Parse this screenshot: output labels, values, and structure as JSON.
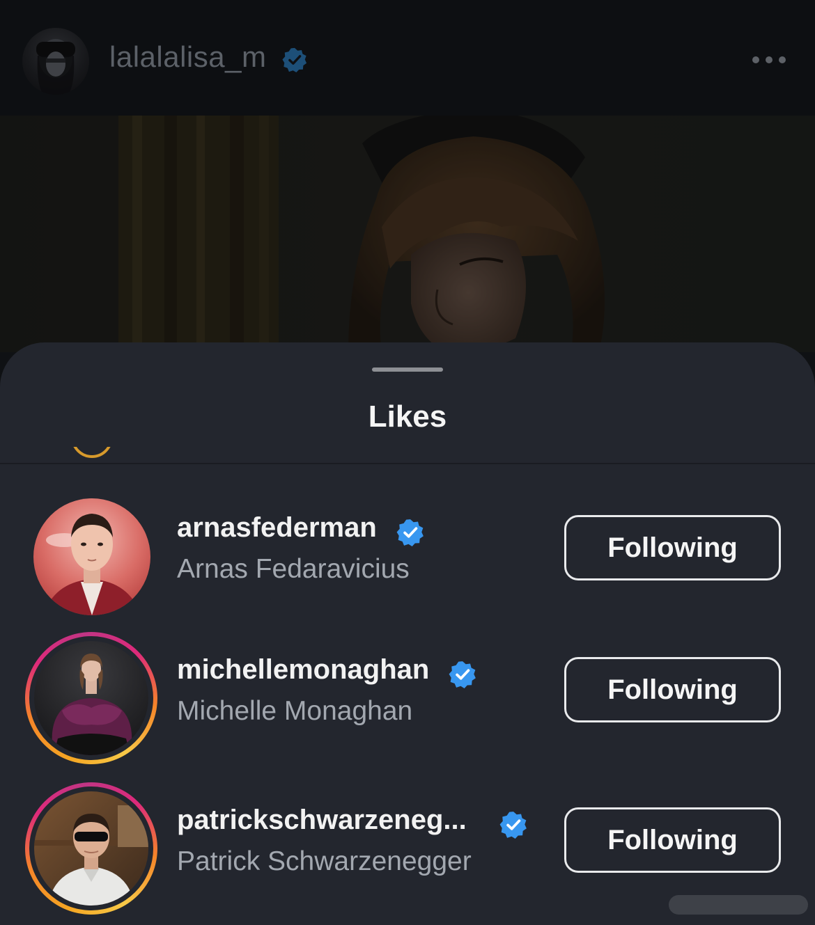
{
  "post": {
    "username": "lalalalisa_m",
    "verified": true,
    "more_icon": "more-horizontal-icon"
  },
  "sheet": {
    "title": "Likes"
  },
  "likes": [
    {
      "username": "arnasfederman",
      "full_name": "Arnas Fedaravicius",
      "verified": true,
      "has_story_ring": false,
      "button_label": "Following"
    },
    {
      "username": "michellemonaghan",
      "full_name": "Michelle Monaghan",
      "verified": true,
      "has_story_ring": true,
      "button_label": "Following"
    },
    {
      "username": "patrickschwarzeneg...",
      "full_name": "Patrick Schwarzenegger",
      "verified": true,
      "has_story_ring": true,
      "button_label": "Following"
    }
  ],
  "colors": {
    "verified_badge": "#3897f0",
    "sheet_background": "#23262e",
    "story_ring_start": "#f5a623",
    "story_ring_end": "#dd2a7b"
  }
}
